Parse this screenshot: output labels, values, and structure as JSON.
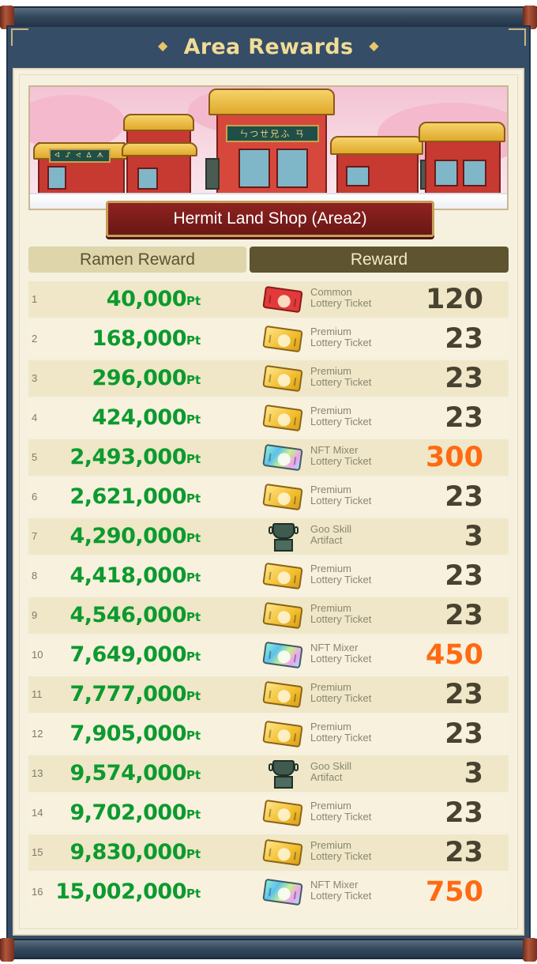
{
  "title": "Area Rewards",
  "shop_name": "Hermit Land Shop (Area2)",
  "banner_sign": "ㄣつㄝ兄ふ ㄢ",
  "columns": {
    "ramen_reward": "Ramen Reward",
    "reward": "Reward"
  },
  "unit": "Pt",
  "colors": {
    "points_green": "#0c9a2e",
    "qty_dark": "#4a4230",
    "qty_highlight": "#ff6a12",
    "frame_blue": "#354d66",
    "title_gold": "#f0dc98"
  },
  "rows": [
    {
      "rank": "1",
      "points": "40,000",
      "icon": "common-lottery-ticket-icon",
      "item": "Common\nLottery Ticket",
      "qty": "120",
      "highlight": false
    },
    {
      "rank": "2",
      "points": "168,000",
      "icon": "premium-lottery-ticket-icon",
      "item": "Premium\nLottery Ticket",
      "qty": "23",
      "highlight": false
    },
    {
      "rank": "3",
      "points": "296,000",
      "icon": "premium-lottery-ticket-icon",
      "item": "Premium\nLottery Ticket",
      "qty": "23",
      "highlight": false
    },
    {
      "rank": "4",
      "points": "424,000",
      "icon": "premium-lottery-ticket-icon",
      "item": "Premium\nLottery Ticket",
      "qty": "23",
      "highlight": false
    },
    {
      "rank": "5",
      "points": "2,493,000",
      "icon": "nft-mixer-lottery-ticket-icon",
      "item": "NFT Mixer\nLottery Ticket",
      "qty": "300",
      "highlight": true
    },
    {
      "rank": "6",
      "points": "2,621,000",
      "icon": "premium-lottery-ticket-icon",
      "item": "Premium\nLottery Ticket",
      "qty": "23",
      "highlight": false
    },
    {
      "rank": "7",
      "points": "4,290,000",
      "icon": "goo-skill-artifact-icon",
      "item": "Goo Skill\nArtifact",
      "qty": "3",
      "highlight": false
    },
    {
      "rank": "8",
      "points": "4,418,000",
      "icon": "premium-lottery-ticket-icon",
      "item": "Premium\nLottery Ticket",
      "qty": "23",
      "highlight": false
    },
    {
      "rank": "9",
      "points": "4,546,000",
      "icon": "premium-lottery-ticket-icon",
      "item": "Premium\nLottery Ticket",
      "qty": "23",
      "highlight": false
    },
    {
      "rank": "10",
      "points": "7,649,000",
      "icon": "nft-mixer-lottery-ticket-icon",
      "item": "NFT Mixer\nLottery Ticket",
      "qty": "450",
      "highlight": true
    },
    {
      "rank": "11",
      "points": "7,777,000",
      "icon": "premium-lottery-ticket-icon",
      "item": "Premium\nLottery Ticket",
      "qty": "23",
      "highlight": false
    },
    {
      "rank": "12",
      "points": "7,905,000",
      "icon": "premium-lottery-ticket-icon",
      "item": "Premium\nLottery Ticket",
      "qty": "23",
      "highlight": false
    },
    {
      "rank": "13",
      "points": "9,574,000",
      "icon": "goo-skill-artifact-icon",
      "item": "Goo Skill\nArtifact",
      "qty": "3",
      "highlight": false
    },
    {
      "rank": "14",
      "points": "9,702,000",
      "icon": "premium-lottery-ticket-icon",
      "item": "Premium\nLottery Ticket",
      "qty": "23",
      "highlight": false
    },
    {
      "rank": "15",
      "points": "9,830,000",
      "icon": "premium-lottery-ticket-icon",
      "item": "Premium\nLottery Ticket",
      "qty": "23",
      "highlight": false
    },
    {
      "rank": "16",
      "points": "15,002,000",
      "icon": "nft-mixer-lottery-ticket-icon",
      "item": "NFT Mixer\nLottery Ticket",
      "qty": "750",
      "highlight": true
    }
  ]
}
